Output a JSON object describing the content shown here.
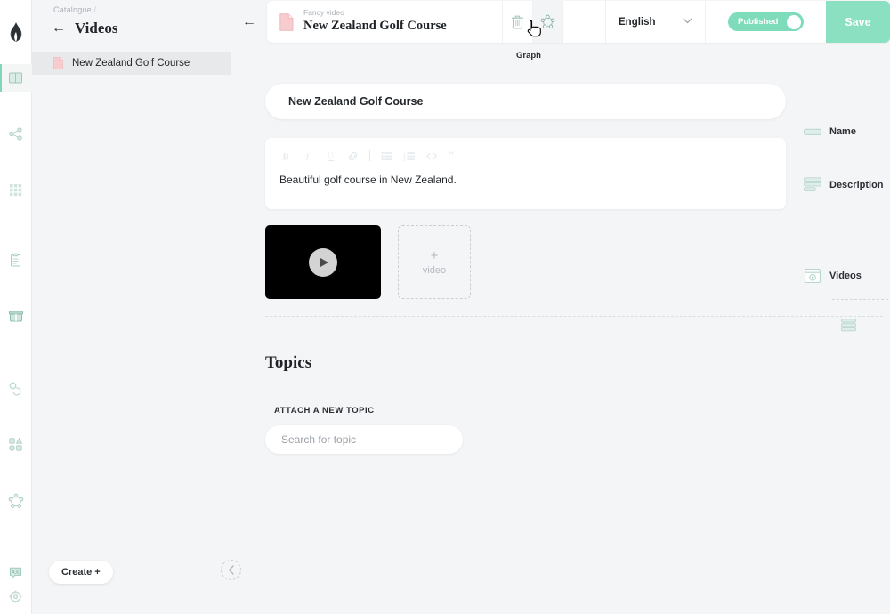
{
  "rail": {
    "logo_icon": "flame-logo-icon",
    "items": [
      {
        "icon": "book-icon",
        "name": "catalogue",
        "active": true
      },
      {
        "icon": "share-nodes-icon",
        "name": "taxonomy",
        "active": false
      },
      {
        "icon": "grid-icon",
        "name": "matrix",
        "active": false
      },
      {
        "icon": "clipboard-icon",
        "name": "forms",
        "active": false
      },
      {
        "icon": "box-icon",
        "name": "packages",
        "active": false
      },
      {
        "icon": "link-icon",
        "name": "links",
        "active": false
      },
      {
        "icon": "shapes-icon",
        "name": "shapes",
        "active": false
      },
      {
        "icon": "graph-nodes-icon",
        "name": "graph",
        "active": false
      }
    ],
    "bottom_items": [
      {
        "icon": "translate-bubble-icon",
        "name": "translations"
      },
      {
        "icon": "gear-icon",
        "name": "settings"
      }
    ]
  },
  "sidebar": {
    "breadcrumb": "Catalogue",
    "breadcrumb_separator": "/",
    "back_arrow": "←",
    "title": "Videos",
    "items": [
      {
        "label": "New Zealand Golf Course",
        "icon": "document-icon",
        "selected": true
      }
    ],
    "create_button": "Create +",
    "collapse_icon": "chevron-left-icon"
  },
  "topbar": {
    "back_arrow": "←",
    "doc_icon": "document-icon",
    "subtitle": "Fancy video",
    "title": "New Zealand Golf Course",
    "delete_icon": "trash-icon",
    "graph_icon": "graph-star-icon",
    "graph_tooltip": "Graph",
    "language": "English",
    "language_chevron": "⌄",
    "published_label": "Published",
    "published_on": true,
    "save_label": "Save"
  },
  "main": {
    "name_value": "New Zealand Golf Course",
    "editor_toolbar": [
      {
        "icon": "bold-icon",
        "glyph": "B"
      },
      {
        "icon": "italic-icon",
        "glyph": "I"
      },
      {
        "icon": "underline-icon",
        "glyph": "U"
      },
      {
        "icon": "link-icon",
        "glyph": "🔗"
      },
      {
        "icon": "bullet-list-icon",
        "glyph": "•"
      },
      {
        "icon": "numbered-list-icon",
        "glyph": "1."
      },
      {
        "icon": "code-icon",
        "glyph": "<>"
      },
      {
        "icon": "quote-icon",
        "glyph": "”"
      }
    ],
    "description_text": "Beautiful golf course in New Zealand.",
    "video_play_icon": "play-icon",
    "add_video_plus": "+",
    "add_video_label": "video",
    "topics_title": "Topics",
    "attach_label": "ATTACH A NEW TOPIC",
    "topic_search_placeholder": "Search for topic",
    "topic_search_value": ""
  },
  "meta": {
    "rows": [
      {
        "label": "Name",
        "icon": "single-line-field-icon"
      },
      {
        "label": "Description",
        "icon": "multi-line-field-icon"
      },
      {
        "label": "Videos",
        "icon": "video-field-icon"
      }
    ],
    "extra_icon": "stacked-list-icon"
  },
  "colors": {
    "accent_green": "#7fdcbb",
    "save_green": "#8ce0c2",
    "doc_pink": "#f5c3c6",
    "page_bg": "#f4f5f7",
    "text_dark": "#24282c"
  }
}
